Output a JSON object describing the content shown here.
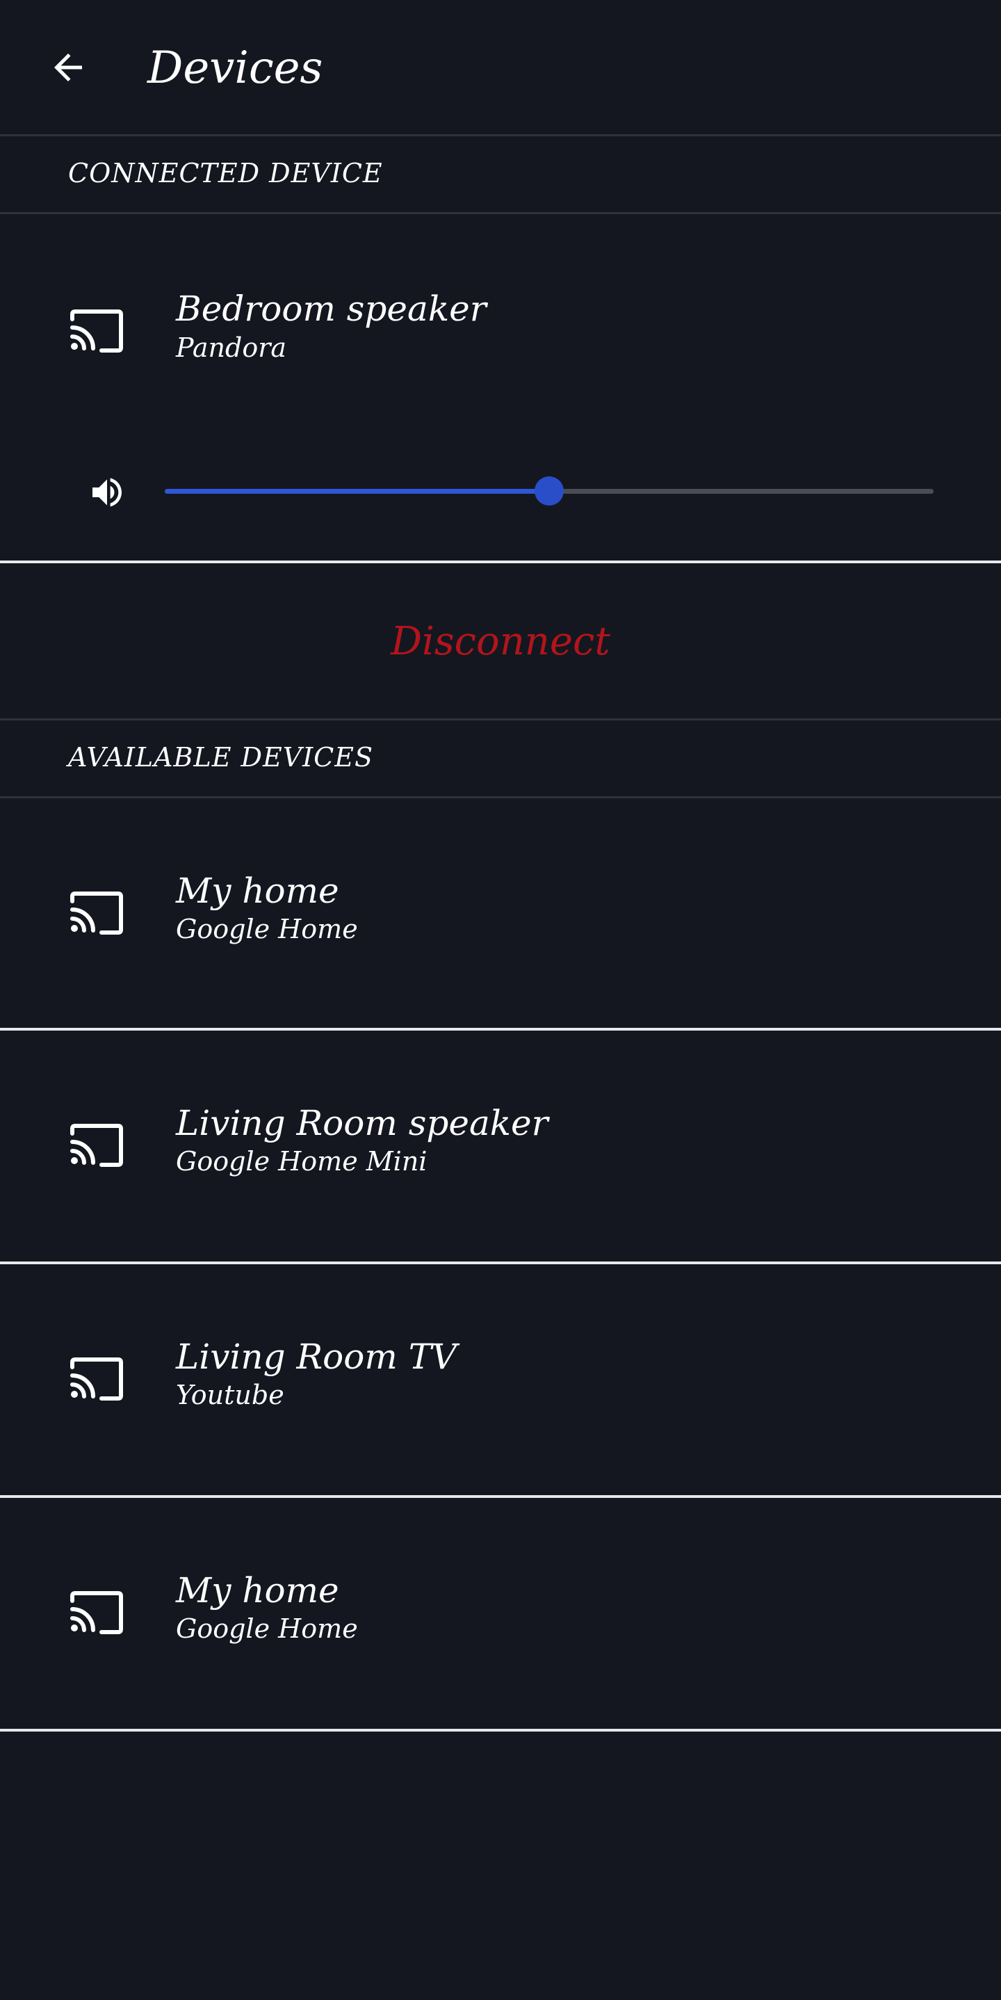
{
  "header": {
    "title": "Devices",
    "back_icon": "arrow-left-icon"
  },
  "connected": {
    "section_label": "CONNECTED DEVICE",
    "device": {
      "name": "Bedroom speaker",
      "subtitle": "Pandora",
      "icon": "cast-icon"
    },
    "volume": {
      "icon": "volume-icon",
      "level_fraction": 0.5
    },
    "disconnect_label": "Disconnect"
  },
  "available": {
    "section_label": "AVAILABLE DEVICES",
    "devices": [
      {
        "name": "My home",
        "subtitle": "Google Home",
        "icon": "cast-icon"
      },
      {
        "name": "Living Room speaker",
        "subtitle": "Google Home Mini",
        "icon": "cast-icon"
      },
      {
        "name": "Living Room TV",
        "subtitle": "Youtube",
        "icon": "cast-icon"
      },
      {
        "name": "My home",
        "subtitle": "Google Home",
        "icon": "cast-icon"
      }
    ]
  },
  "colors": {
    "background": "#141720",
    "accent": "#2f56d6",
    "danger": "#b3141b",
    "text": "#ffffff"
  }
}
